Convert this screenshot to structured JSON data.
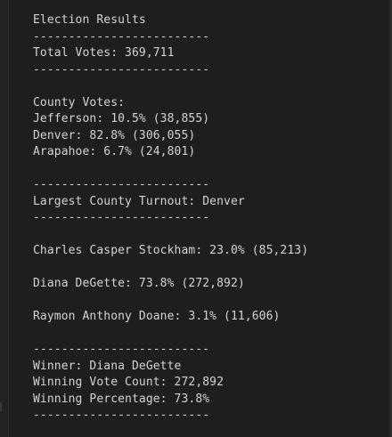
{
  "terminal": {
    "lines": [
      "Election Results",
      "-------------------------",
      "Total Votes: 369,711",
      "-------------------------",
      "",
      "County Votes:",
      "Jefferson: 10.5% (38,855)",
      "Denver: 82.8% (306,055)",
      "Arapahoe: 6.7% (24,801)",
      "",
      "-------------------------",
      "Largest County Turnout: Denver",
      "-------------------------",
      "",
      "Charles Casper Stockham: 23.0% (85,213)",
      "",
      "Diana DeGette: 73.8% (272,892)",
      "",
      "Raymon Anthony Doane: 3.1% (11,606)",
      "",
      "-------------------------",
      "Winner: Diana DeGette",
      "Winning Vote Count: 272,892",
      "Winning Percentage: 73.8%",
      "-------------------------"
    ]
  }
}
